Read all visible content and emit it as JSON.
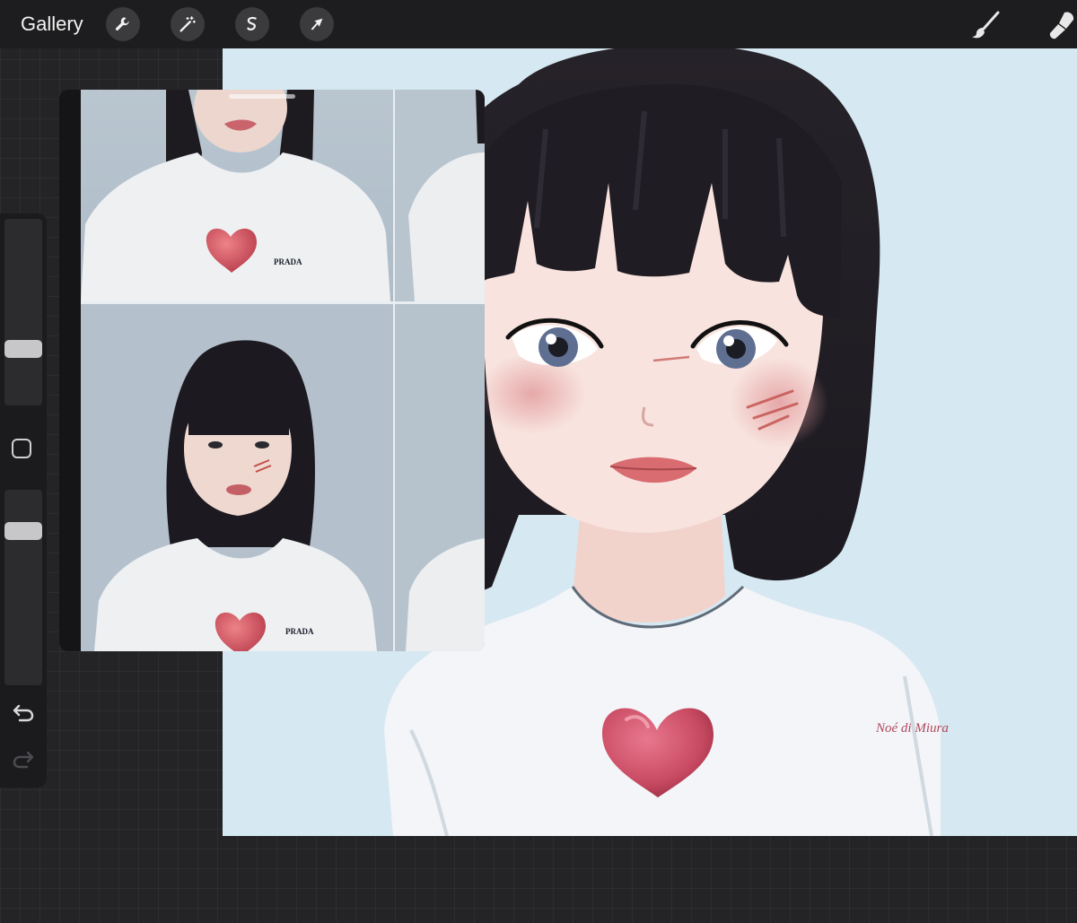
{
  "toolbar": {
    "gallery_label": "Gallery",
    "left_tools": [
      "wrench-icon",
      "magic-wand-icon",
      "selection-icon",
      "transform-arrow-icon"
    ],
    "right_tools": [
      "brush-icon",
      "smudge-icon"
    ]
  },
  "sidebar": {
    "brush_size_level": 0.28,
    "opacity_level": 0.82,
    "controls": [
      "modify-square",
      "undo-icon",
      "redo-icon"
    ]
  },
  "canvas": {
    "background_color": "#d6e8f1",
    "signature_text": "Noé di Miura"
  },
  "reference": {
    "photos": [
      "photo-top-crop",
      "photo-top-side",
      "photo-portrait",
      "photo-portrait-side"
    ],
    "brand_text": "PRADA"
  }
}
